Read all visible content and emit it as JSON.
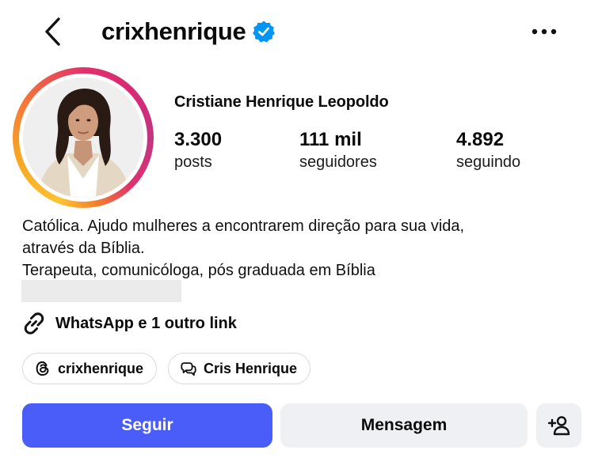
{
  "header": {
    "username": "crixhenrique",
    "verified_icon": "verified-badge-icon",
    "back_icon": "chevron-left-icon",
    "more_icon": "more-horizontal-icon"
  },
  "profile": {
    "full_name": "Cristiane Henrique Leopoldo",
    "avatar_icon": "profile-photo",
    "stats": [
      {
        "value": "3.300",
        "label": "posts"
      },
      {
        "value": "111 mil",
        "label": "seguidores"
      },
      {
        "value": "4.892",
        "label": "seguindo"
      }
    ]
  },
  "bio": {
    "lines": [
      "Católica. Ajudo mulheres a encontrarem direção para sua vida,",
      "através da Bíblia.",
      "Terapeuta, comunicóloga, pós graduada em Bíblia"
    ]
  },
  "links": {
    "icon": "link-icon",
    "label": "WhatsApp e 1 outro link"
  },
  "chips": [
    {
      "icon": "threads-icon",
      "label": "crixhenrique"
    },
    {
      "icon": "message-bubble-icon",
      "label": "Cris Henrique"
    }
  ],
  "actions": {
    "follow": "Seguir",
    "message": "Mensagem",
    "add_user_icon": "add-user-icon"
  },
  "colors": {
    "follow_button": "#4a5df9",
    "verified_badge": "#0095f6",
    "secondary_button": "#eff0f3"
  }
}
